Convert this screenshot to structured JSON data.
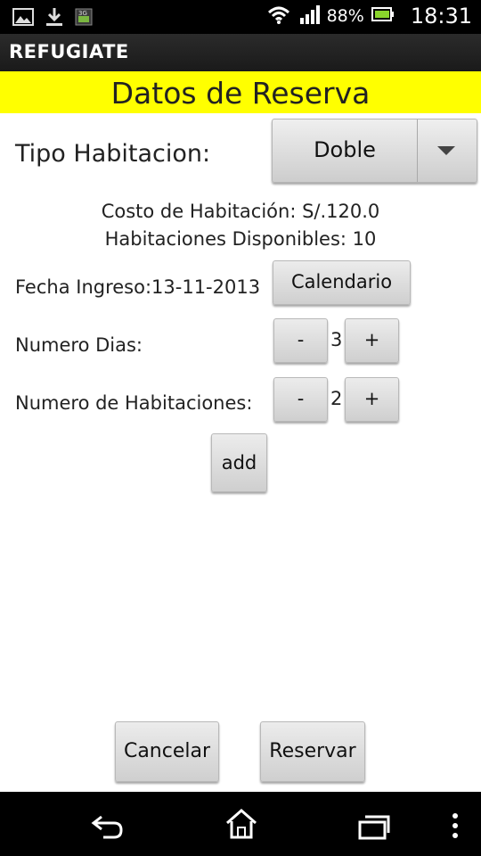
{
  "status_bar": {
    "battery_percent": "88%",
    "time": "18:31",
    "icons": [
      "gallery-icon",
      "download-icon",
      "app-notification-icon",
      "wifi-icon",
      "signal-icon",
      "battery-icon"
    ]
  },
  "app": {
    "title": "REFUGIATE"
  },
  "header": {
    "title": "Datos de Reserva"
  },
  "form": {
    "tipo_label": "Tipo Habitacion:",
    "tipo_value": "Doble",
    "costo": "Costo de Habitación: S/.120.0",
    "disponibles": "Habitaciones Disponibles: 10",
    "fecha_label": "Fecha Ingreso:13-11-2013",
    "calendario_button": "Calendario",
    "dias_label": "Numero Dias:",
    "dias_value": "3",
    "habitaciones_label": "Numero de Habitaciones:",
    "habitaciones_value": "2",
    "minus": "-",
    "plus": "+",
    "add_button": "add"
  },
  "footer": {
    "cancel": "Cancelar",
    "reserve": "Reservar"
  },
  "colors": {
    "header_bg": "#ffff00",
    "status_bg": "#000000",
    "actionbar_bg": "#1f1f1f"
  }
}
